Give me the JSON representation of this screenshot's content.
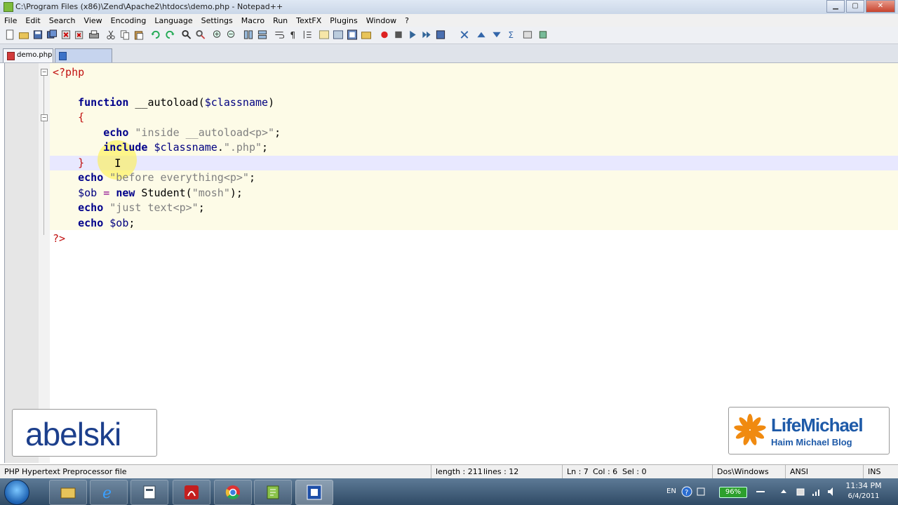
{
  "window": {
    "title": "C:\\Program Files (x86)\\Zend\\Apache2\\htdocs\\demo.php - Notepad++"
  },
  "menu": [
    "File",
    "Edit",
    "Search",
    "View",
    "Encoding",
    "Language",
    "Settings",
    "Macro",
    "Run",
    "TextFX",
    "Plugins",
    "Window",
    "?"
  ],
  "tabs": [
    {
      "label": "demo.php",
      "active": true
    },
    {
      "label": "",
      "active": false
    }
  ],
  "code": {
    "lines": [
      "<?php",
      "",
      "    function __autoload($classname)",
      "    {",
      "        echo \"inside __autoload<p>\";",
      "        include $classname.\".php\";",
      "    }",
      "    echo \"before everything<p>\";",
      "    $ob = new Student(\"mosh\");",
      "    echo \"just text<p>\";",
      "    echo $ob;",
      "?>"
    ]
  },
  "status": {
    "file_type": "PHP Hypertext Preprocessor file",
    "length": "length : 211",
    "lines": "lines : 12",
    "ln": "Ln : 7",
    "col": "Col : 6",
    "sel": "Sel : 0",
    "eol": "Dos\\Windows",
    "encoding": "ANSI",
    "mode": "INS"
  },
  "watermarks": {
    "left": "abelski",
    "right_name": "LifeMichael",
    "right_sub": "Haim Michael Blog"
  },
  "taskbar": {
    "language": "EN",
    "battery": "96%",
    "time": "11:34 PM",
    "date": "6/4/2011"
  },
  "colors": {
    "php_tag": "#c11010",
    "keyword": "#00008b",
    "string": "#808080",
    "current_line": "#e8e8ff",
    "code_background": "#fdfbe7"
  }
}
